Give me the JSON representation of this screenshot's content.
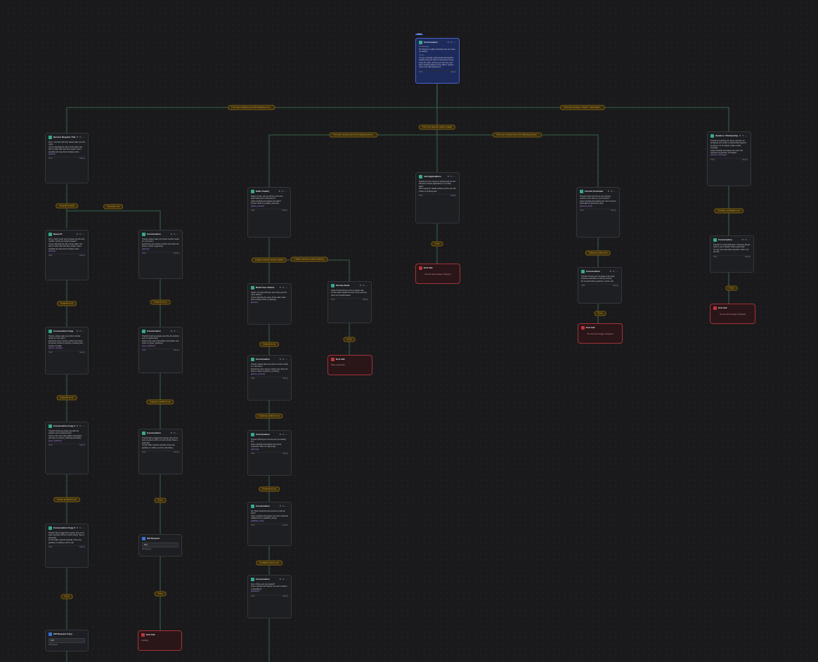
{
  "start_badge": "START",
  "nodes": {
    "start": {
      "title": "Conversation",
      "first_message_label": "First Message",
      "first_message": "Hi! Thanks for calling Umbrella, how can I help you today?",
      "prompt_label": "Prompt",
      "prompt": "You are a friendly, professional call assistant handling inbound calls for {{company.name}}. Greet the caller, ask how you can help, and listen carefully. Based on the caller's request, route to the right department.",
      "foot_left": "Tools",
      "foot_right": "Latency"
    },
    "sjm": {
      "title": "Service Request / Status",
      "first_message": "Sure, I can help with that, please state your full name.",
      "prompt": "You're collecting the name of the caller. Ask them to state their full name clearly. Listen carefully and save their complete name.",
      "var": "{{name}}",
      "foot_left": "Tools",
      "foot_right": "Latency"
    },
    "name2": {
      "title": "Name Pt",
      "first_message": "Sorry, I didn't catch your full name and the last number. Could you repeat it please?",
      "prompt": "You're collecting the name of the caller. Ask them to state their full name clearly. Listen carefully and save their complete name.",
      "var": "{{name}}",
      "foot_left": "Tools",
      "foot_right": "Latency"
    },
    "conv_phone_a": {
      "title": "Conversation",
      "first_message": "Thanks, please state your phone number slowly so I can note it.",
      "prompt": "Extract the user's phone number only. Store the phone number in {{phone}}.",
      "var": "{{phone}}",
      "foot_left": "Tools",
      "foot_right": "Latency"
    },
    "conv_copy": {
      "title": "Conversation Copy",
      "first_message": "Thanks, please state your phone number slowly so I can note it.",
      "prompt": "Extract the user's phone number only. Store the phone number in {{phone_number}} and ensure it is valid.",
      "var": "{{phone_number}}",
      "foot_left": "Tools",
      "foot_right": "Latency"
    },
    "conv_problem": {
      "title": "Conversation",
      "first_message": "Thanks! Could you please describe the problem you're experiencing?",
      "prompt": "Listen to the user's full problem description and store it in {{user_problem}}.",
      "var": "{{user_problem}}",
      "foot_left": "Tools",
      "foot_right": "Latency"
    },
    "conv_copy2": {
      "title": "Conversation Copy 2",
      "first_message": "Thanks! Could you please describe the problem you're experiencing?",
      "prompt": "Listen to the user's full problem description and store it in {{user_problem}} accurately.",
      "var": "{{user_problem}}",
      "foot_left": "Tools",
      "foot_right": "Latency"
    },
    "conv_ack": {
      "title": "Conversation",
      "first_message": "Thanks! We've logged the request. One of our team members will be in touch shortly. Have a great day!",
      "prompt": "Let the caller respond naturally. If they say goodbye or nothing, end the call politely.",
      "foot_left": "Tools",
      "foot_right": "Latency"
    },
    "conv_copy3": {
      "title": "Conversation Copy 3",
      "first_message": "Thanks! We've logged the request. One of our team members will be in touch shortly. Have a great day!",
      "prompt": "Let the caller respond naturally. If they say goodbye or nothing, end the call.",
      "foot_left": "Tools",
      "foot_right": "Latency"
    },
    "api_req": {
      "title": "API Request",
      "method": "Post",
      "sub": "API Request"
    },
    "api_copy": {
      "title": "API Request Copy",
      "method": "Post",
      "sub": "API Request"
    },
    "end_left": {
      "title": "End Call",
      "message": "Goodbye"
    },
    "sales": {
      "title": "Sales Inquiry",
      "first_message": "Happy to help, can you tell me a bit more about what you're interested in?",
      "prompt": "Listen carefully and capture the caller's interest. Store it in {{sales_interest}}.",
      "var": "{{sales_interest}}",
      "foot_left": "Tools",
      "foot_right": "Latency"
    },
    "build": {
      "title": "Build Your Claims",
      "first_message": "Great! I can help with that. Can I take your full name please?",
      "prompt": "You're collecting the name of the caller. Save their complete name in {{name}}.",
      "var": "{{name}}",
      "foot_left": "Tools",
      "foot_right": "Latency"
    },
    "review": {
      "title": "Service Desk",
      "first_message": "Good, I'll help with an error so please wait",
      "prompt": "Let the caller explain the issue. Then send the call to our technical team.",
      "foot_left": "Tools",
      "foot_right": "Latency"
    },
    "end_review": {
      "title": "End Call",
      "message": "Have a great day!"
    },
    "conv_m1": {
      "title": "Conversation",
      "first_message": "Thanks, please state your phone number slowly so I can note it.",
      "prompt": "Extract the user's phone number only. Store the phone number in {{phone_number}}.",
      "var": "{{phone_number}}",
      "foot_left": "Tools",
      "foot_right": "Latency"
    },
    "conv_m2": {
      "title": "Conversation",
      "first_message": "Thanks! What type of service are you looking for?",
      "prompt": "Listen carefully and capture the service requested. Store it in {{service}}.",
      "var": "{{service}}",
      "foot_left": "Tools",
      "foot_right": "Latency"
    },
    "conv_m3": {
      "title": "Conversation",
      "first_message": "Ok. When would be the best time to call you back?",
      "prompt": "Listen carefully and capture the user's preferred callback time in {{callback_time}}.",
      "var": "{{callback_time}}",
      "foot_left": "Tools",
      "foot_right": "Latency"
    },
    "conv_m4": {
      "title": "Conversation",
      "first_message": "Got it. Where are you located?",
      "prompt": "Listen carefully and capture the user's location in {{location}}.",
      "var": "{{location}}",
      "foot_left": "Tools",
      "foot_right": "Latency"
    },
    "job": {
      "title": "Job Applications",
      "first_message": "Thanks for your interest in working with us! Our HR team reviews applications on a rolling basis.",
      "prompt": "After saying the details politely end the call. Ask if there is anything else.",
      "foot_left": "Tools",
      "foot_right": "Latency"
    },
    "end_job": {
      "title": "End Call",
      "message": "No end call message configured"
    },
    "current": {
      "title": "Current Customer",
      "first_message": "Thanks! Could you tell me your account number or the name on your account?",
      "prompt": "Listen carefully and capture the user's account information in {{account_info}}.",
      "var": "{{account_info}}",
      "foot_left": "Tools",
      "foot_right": "Latency"
    },
    "conv_cc": {
      "title": "Conversation",
      "first_message": "Thanks! I'll pass your message to the team. Someone will follow up with you shortly.",
      "prompt": "Do not ask further questions, end the call.",
      "foot_left": "Tools",
      "foot_right": "Latency"
    },
    "end_cc": {
      "title": "End Call",
      "message": "No end call message configured"
    },
    "vendor": {
      "title": "Vendors / Partnerships / Fr...",
      "first_message": "Thanks for reaching out. We're currently not accepting new vendor or partnership requests by phone, but I'm happy to take a quick message.",
      "prompt": "Listen carefully and capture the user's full response as {{vendor_message}}.",
      "var": "{{vendor_message}}",
      "foot_left": "Tools",
      "foot_right": "Latency"
    },
    "conv_v": {
      "title": "Conversation",
      "first_message": "Thanks! I've noted that down. Someone will get back to you if needed. Have a good day!",
      "prompt": "You are not to ask other questions. Then end the call.",
      "foot_left": "Tools",
      "foot_right": "Latency"
    },
    "end_v": {
      "title": "End Call",
      "message": "No end call message configured"
    }
  },
  "conditions": {
    "c_left": "If the user mentions any of the following: not a...",
    "c_right": "If the user mentions, \"vendor\", \"partnership\"...",
    "c_center": "If the user says job, career or apply",
    "c_sales": "If the user mentions any of the following service...",
    "c_cur": "If the user mentions any of the following phrases...",
    "c_name_invalid": "If {name} is empty",
    "c_name_valid": "If {name} is not",
    "c_phone_a": "If {phone} is not",
    "c_name2": "If {name} is not",
    "c_prob_a": "If {phone_number} is not",
    "c_phone_copy": "If {phone} is not",
    "c_prob_copy": "If {user_problem} is not",
    "c_ack_a": "If true",
    "c_true_l": "If true",
    "c_true_l2": "If true",
    "c_sales_a": "If {sales_interest} contains repairs",
    "c_sales_b": "If {sales_interest} contains business",
    "c_build": "If {name} is not",
    "c_m1": "If {phone_number} is not",
    "c_m2": "If {service} is not",
    "c_m3": "If {callback_time} is not",
    "c_review": "If true",
    "c_job": "If true",
    "c_cur2": "If {account_info} is not",
    "c_cc": "If true",
    "c_vendor": "If {vendor_message} is not",
    "c_v": "If true"
  }
}
